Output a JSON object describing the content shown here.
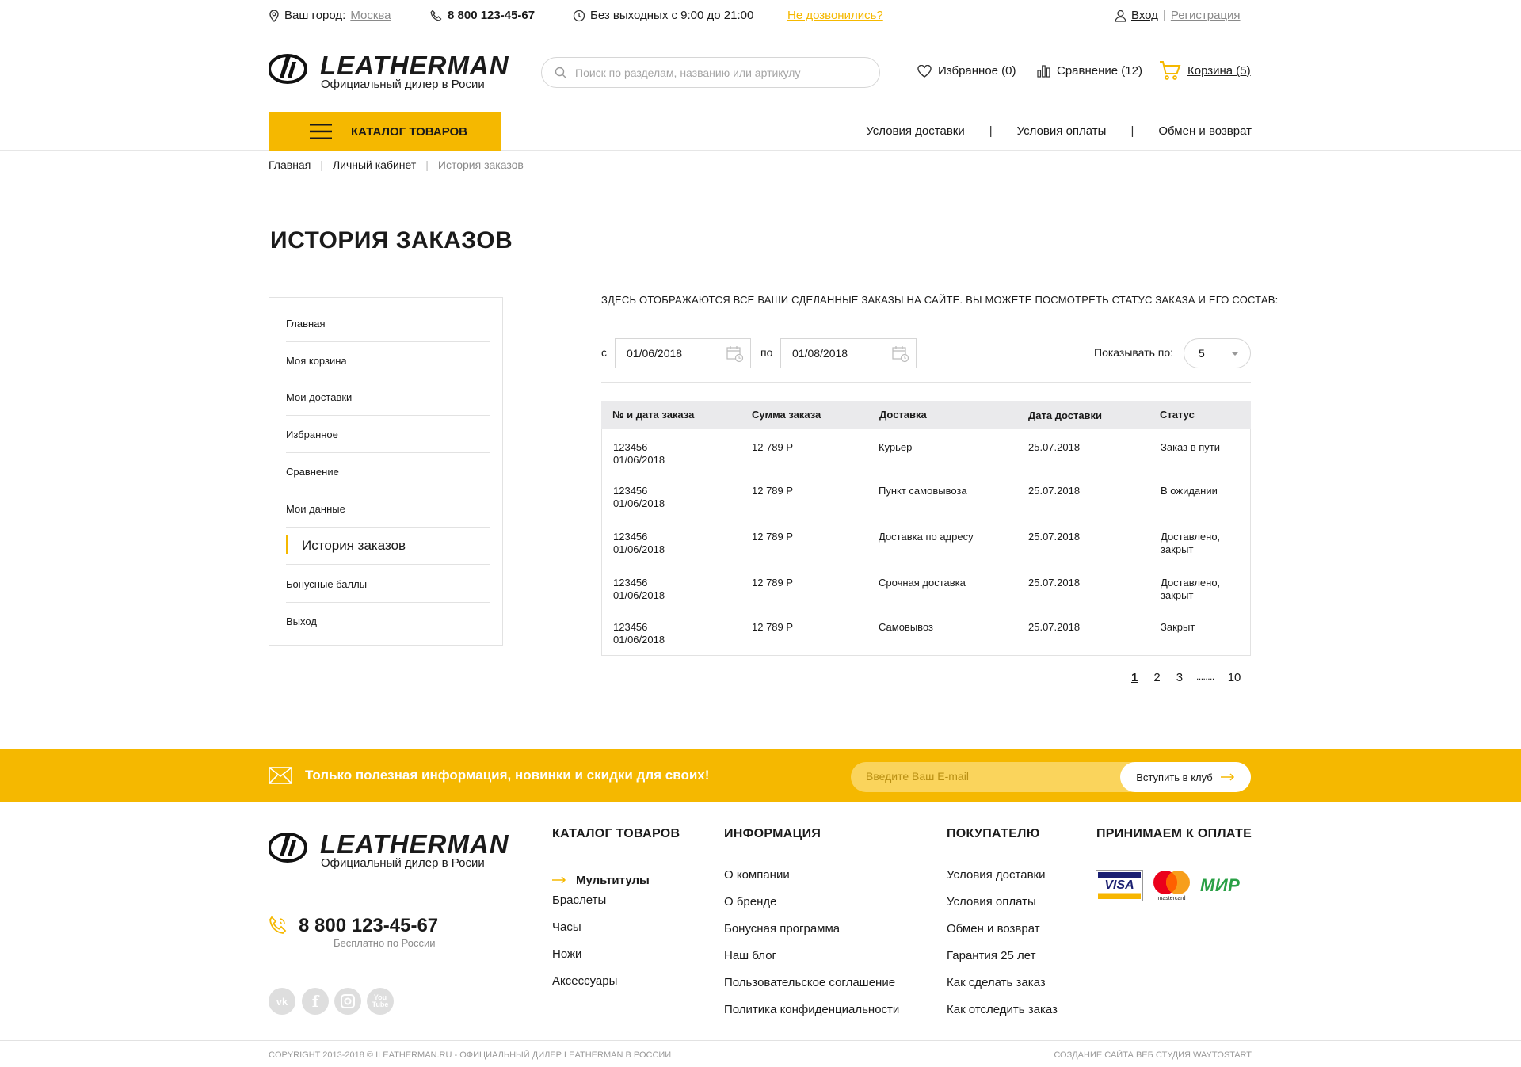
{
  "topbar": {
    "city_label": "Ваш город:",
    "city": "Москва",
    "phone": "8 800 123-45-67",
    "hours": "Без выходных с 9:00 до 21:00",
    "callback": "Не дозвонились?",
    "login": "Вход",
    "register": "Регистрация"
  },
  "header": {
    "logo_text": "LEATHERMAN",
    "logo_sub": "Официальный дилер в Росии",
    "search_placeholder": "Поиск по разделам, названию или артикулу",
    "favorites": "Избранное (0)",
    "compare": "Сравнение (12)",
    "cart": "Корзина (5)"
  },
  "nav": {
    "catalog": "КАТАЛОГ ТОВАРОВ",
    "links": [
      "Условия доставки",
      "Условия оплаты",
      "Обмен и возврат"
    ]
  },
  "breadcrumb": [
    "Главная",
    "Личный кабинет",
    "История заказов"
  ],
  "page_title": "ИСТОРИЯ ЗАКАЗОВ",
  "side_menu": [
    "Главная",
    "Моя корзина",
    "Мои доставки",
    "Избранное",
    "Сравнение",
    "Мои данные",
    "История заказов",
    "Бонусные баллы",
    "Выход"
  ],
  "intro": "ЗДЕСЬ ОТОБРАЖАЮТСЯ ВСЕ ВАШИ СДЕЛАННЫЕ ЗАКАЗЫ НА САЙТЕ. ВЫ МОЖЕТЕ ПОСМОТРЕТЬ СТАТУС ЗАКАЗА И ЕГО СОСТАВ:",
  "filter": {
    "from_label": "с",
    "from": "01/06/2018",
    "to_label": "по",
    "to": "01/08/2018",
    "per_page_label": "Показывать по:",
    "per_page": "5"
  },
  "table": {
    "headers": [
      "№ и дата заказа",
      "Сумма заказа",
      "Доставка",
      "Дата доставки",
      "Статус"
    ],
    "rows": [
      {
        "num": "123456",
        "date": "01/06/2018",
        "sum": "12 789 Р",
        "delivery": "Курьер",
        "delivery_date": "25.07.2018",
        "status": "Заказ в пути"
      },
      {
        "num": "123456",
        "date": "01/06/2018",
        "sum": "12 789 Р",
        "delivery": "Пункт самовывоза",
        "delivery_date": "25.07.2018",
        "status": "В ожидании"
      },
      {
        "num": "123456",
        "date": "01/06/2018",
        "sum": "12 789 Р",
        "delivery": "Доставка по адресу",
        "delivery_date": "25.07.2018",
        "status": "Доставлено, закрыт"
      },
      {
        "num": "123456",
        "date": "01/06/2018",
        "sum": "12 789 Р",
        "delivery": "Срочная доставка",
        "delivery_date": "25.07.2018",
        "status": "Доставлено, закрыт"
      },
      {
        "num": "123456",
        "date": "01/06/2018",
        "sum": "12 789 Р",
        "delivery": "Самовывоз",
        "delivery_date": "25.07.2018",
        "status": "Закрыт"
      }
    ]
  },
  "pagination": [
    "1",
    "2",
    "3",
    "........",
    "10"
  ],
  "subscribe": {
    "text": "Только полезная информация, новинки и скидки для своих!",
    "placeholder": "Введите Ваш E-mail",
    "button": "Вступить в клуб"
  },
  "footer": {
    "phone": "8 800 123-45-67",
    "phone_note": "Бесплатно по России",
    "catalog_title": "КАТАЛОГ ТОВАРОВ",
    "catalog": [
      "Мультитулы",
      "Браслеты",
      "Часы",
      "Ножи",
      "Аксессуары"
    ],
    "info_title": "ИНФОРМАЦИЯ",
    "info": [
      "О компании",
      "О бренде",
      "Бонусная программа",
      "Наш блог",
      "Пользовательское соглашение",
      "Политика конфиденциальности"
    ],
    "buyer_title": "ПОКУПАТЕЛЮ",
    "buyer": [
      "Условия доставки",
      "Условия оплаты",
      "Обмен и возврат",
      "Гарантия 25 лет",
      "Как сделать заказ",
      "Как отследить заказ"
    ],
    "payment_title": "ПРИНИМАЕМ К ОПЛАТЕ",
    "payment": [
      "VISA",
      "mastercard",
      "МИР"
    ],
    "social": [
      "vk",
      "f",
      "ig",
      "You Tube"
    ],
    "copyright": "COPYRIGHT 2013-2018 © ILEATHERMAN.RU - ОФИЦИАЛЬНЫЙ ДИЛЕР LEATHERMAN В РОССИИ",
    "made_by": "СОЗДАНИЕ САЙТА ВЕБ СТУДИЯ WAYTOSTART"
  },
  "colors": {
    "accent": "#f5b800",
    "text": "#1a1a1a",
    "border": "#e2e2e2"
  }
}
